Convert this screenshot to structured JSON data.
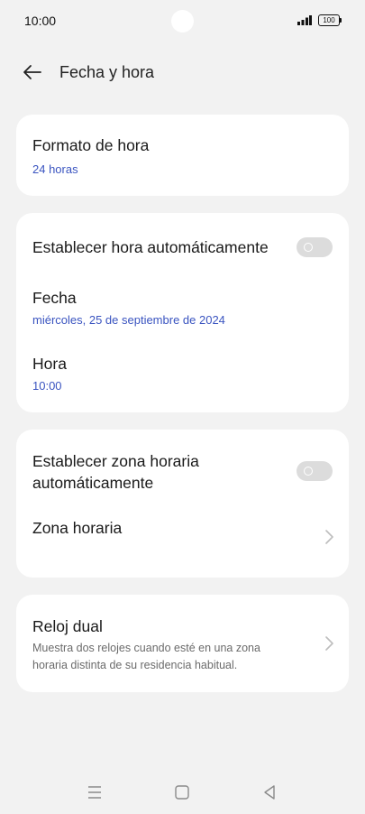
{
  "status": {
    "time": "10:00",
    "battery": "100"
  },
  "header": {
    "title": "Fecha y hora"
  },
  "time_format": {
    "title": "Formato de hora",
    "value": "24 horas"
  },
  "auto_time": {
    "label": "Establecer hora automáticamente",
    "enabled": false
  },
  "date": {
    "title": "Fecha",
    "value": "miércoles, 25 de septiembre de 2024"
  },
  "time": {
    "title": "Hora",
    "value": "10:00"
  },
  "auto_zone": {
    "label_line1": "Establecer zona horaria",
    "label_line2": "automáticamente",
    "enabled": false
  },
  "timezone": {
    "title": "Zona horaria"
  },
  "dual_clock": {
    "title": "Reloj dual",
    "desc_line1": "Muestra dos relojes cuando esté en una zona",
    "desc_line2": "horaria distinta de su residencia habitual."
  },
  "icons": [
    "back-arrow-icon",
    "chevron-right-icon",
    "menu-icon",
    "home-icon",
    "back-icon",
    "signal-icon",
    "battery-icon"
  ],
  "colors": {
    "accent": "#3a54c0",
    "background": "#f2f2f2",
    "toggle_off": "#dcdcdc"
  }
}
